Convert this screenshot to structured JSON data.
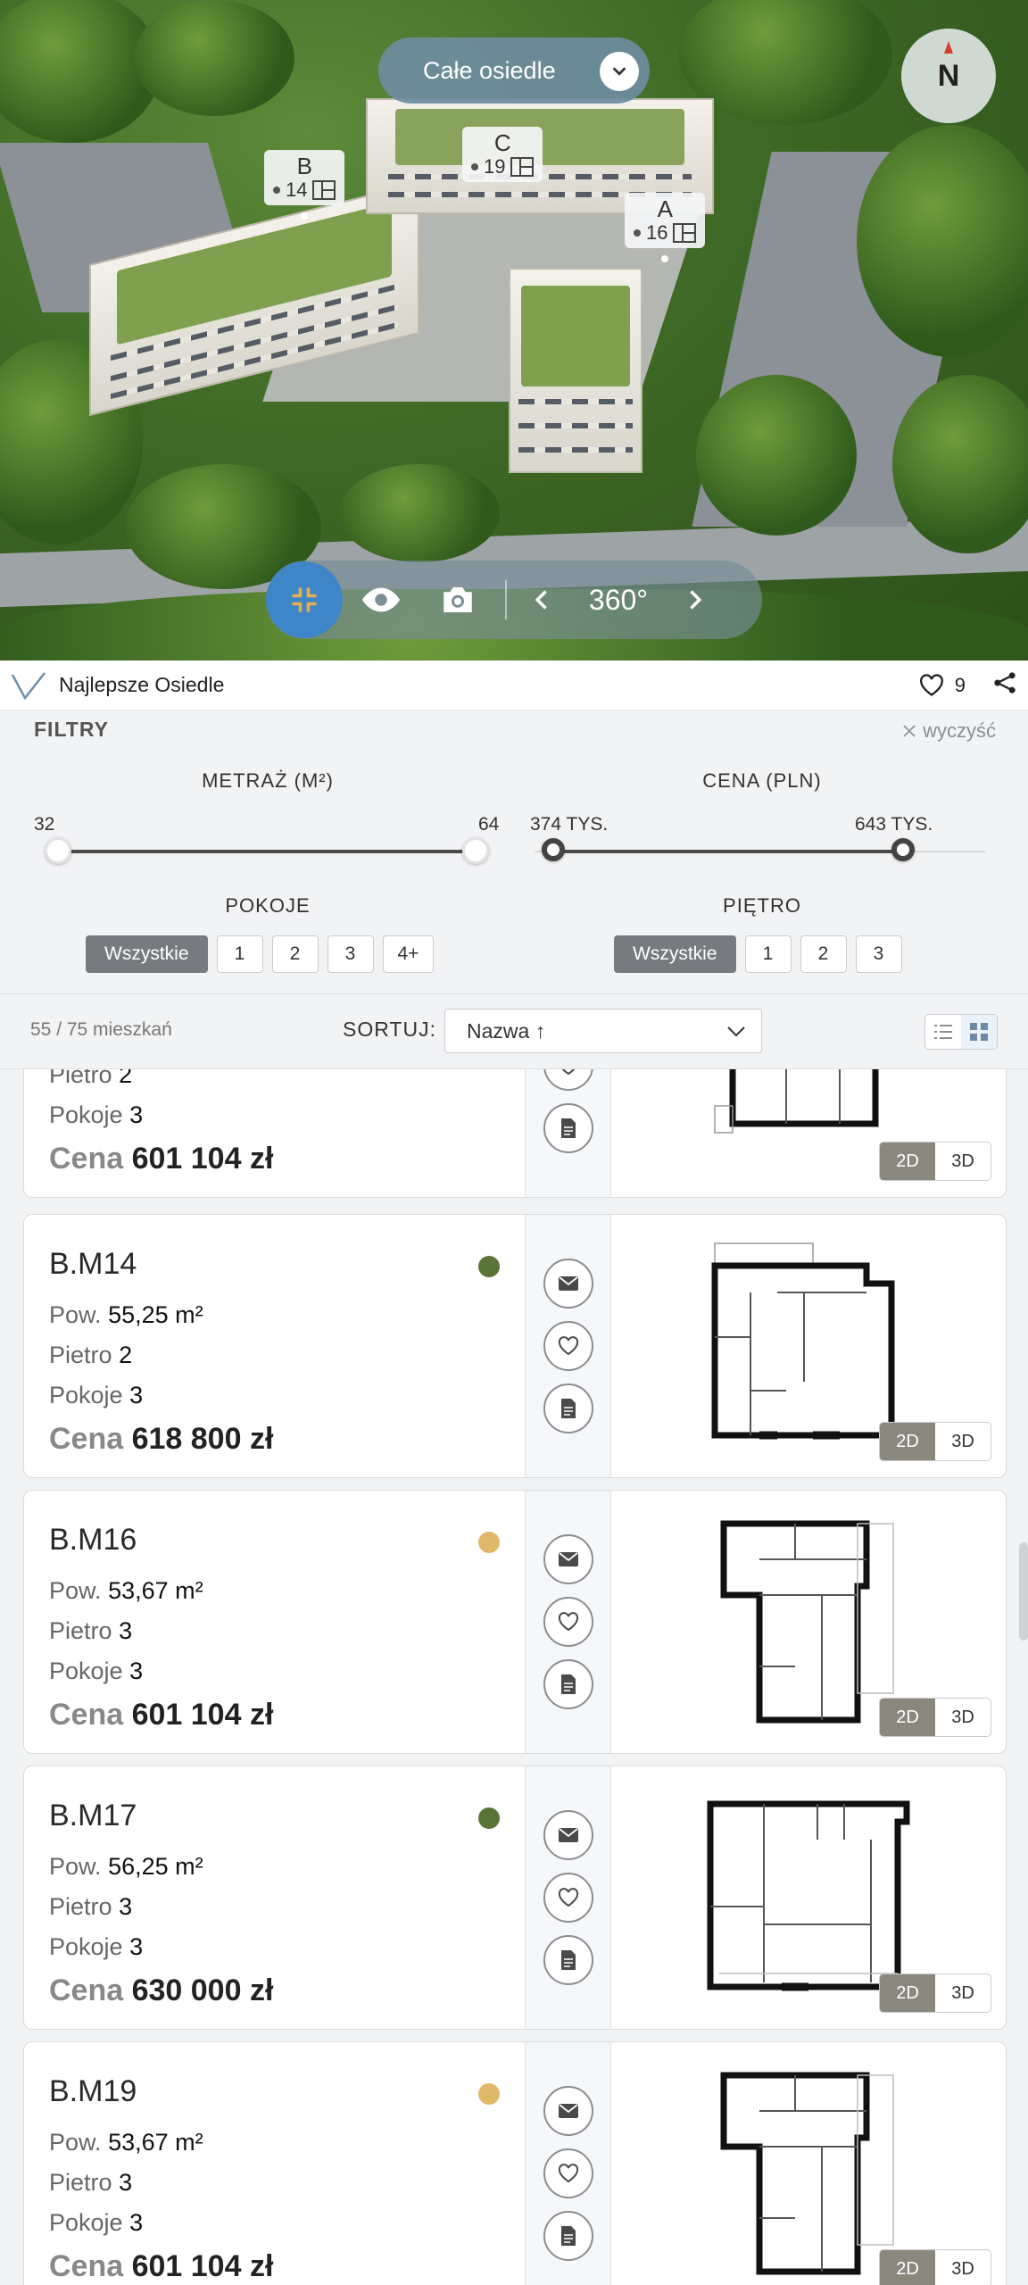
{
  "aerial": {
    "site_select_label": "Całe osiedle",
    "compass_label": "N",
    "buildings": [
      {
        "letter": "B",
        "count": "14"
      },
      {
        "letter": "C",
        "count": "19"
      },
      {
        "letter": "A",
        "count": "16"
      }
    ],
    "toolbar": {
      "degrees": "360°"
    }
  },
  "appbar": {
    "brand": "Najlepsze Osiedle",
    "favorites_count": "9"
  },
  "filters": {
    "title": "FILTRY",
    "clear_label": "wyczyść",
    "area": {
      "label": "METRAŻ (M²)",
      "min": "32",
      "max": "64"
    },
    "price": {
      "label": "CENA (PLN)",
      "min": "374 TYS.",
      "max": "643 TYS."
    },
    "rooms": {
      "label": "POKOJE",
      "options": [
        "Wszystkie",
        "1",
        "2",
        "3",
        "4+"
      ],
      "selected": "Wszystkie"
    },
    "floor": {
      "label": "PIĘTRO",
      "options": [
        "Wszystkie",
        "1",
        "2",
        "3"
      ],
      "selected": "Wszystkie"
    }
  },
  "sort": {
    "count": "55 / 75 mieszkań",
    "label": "SORTUJ:",
    "value": "Nazwa ↑"
  },
  "labels": {
    "area": "Pow.",
    "floor": "Pietro",
    "rooms": "Pokoje",
    "price": "Cena",
    "view_2d": "2D",
    "view_3d": "3D"
  },
  "colors": {
    "available": "#5a7436",
    "reserved": "#e0b86a"
  },
  "apartments": [
    {
      "code": "",
      "area": "",
      "floor": "2",
      "rooms": "3",
      "price": "601 104 zł",
      "status": ""
    },
    {
      "code": "B.M14",
      "area": "55,25 m²",
      "floor": "2",
      "rooms": "3",
      "price": "618 800 zł",
      "status": "#5a7436"
    },
    {
      "code": "B.M16",
      "area": "53,67 m²",
      "floor": "3",
      "rooms": "3",
      "price": "601 104 zł",
      "status": "#e0b86a"
    },
    {
      "code": "B.M17",
      "area": "56,25 m²",
      "floor": "3",
      "rooms": "3",
      "price": "630 000 zł",
      "status": "#5a7436"
    },
    {
      "code": "B.M19",
      "area": "53,67 m²",
      "floor": "3",
      "rooms": "3",
      "price": "601 104 zł",
      "status": "#e0b86a"
    }
  ]
}
